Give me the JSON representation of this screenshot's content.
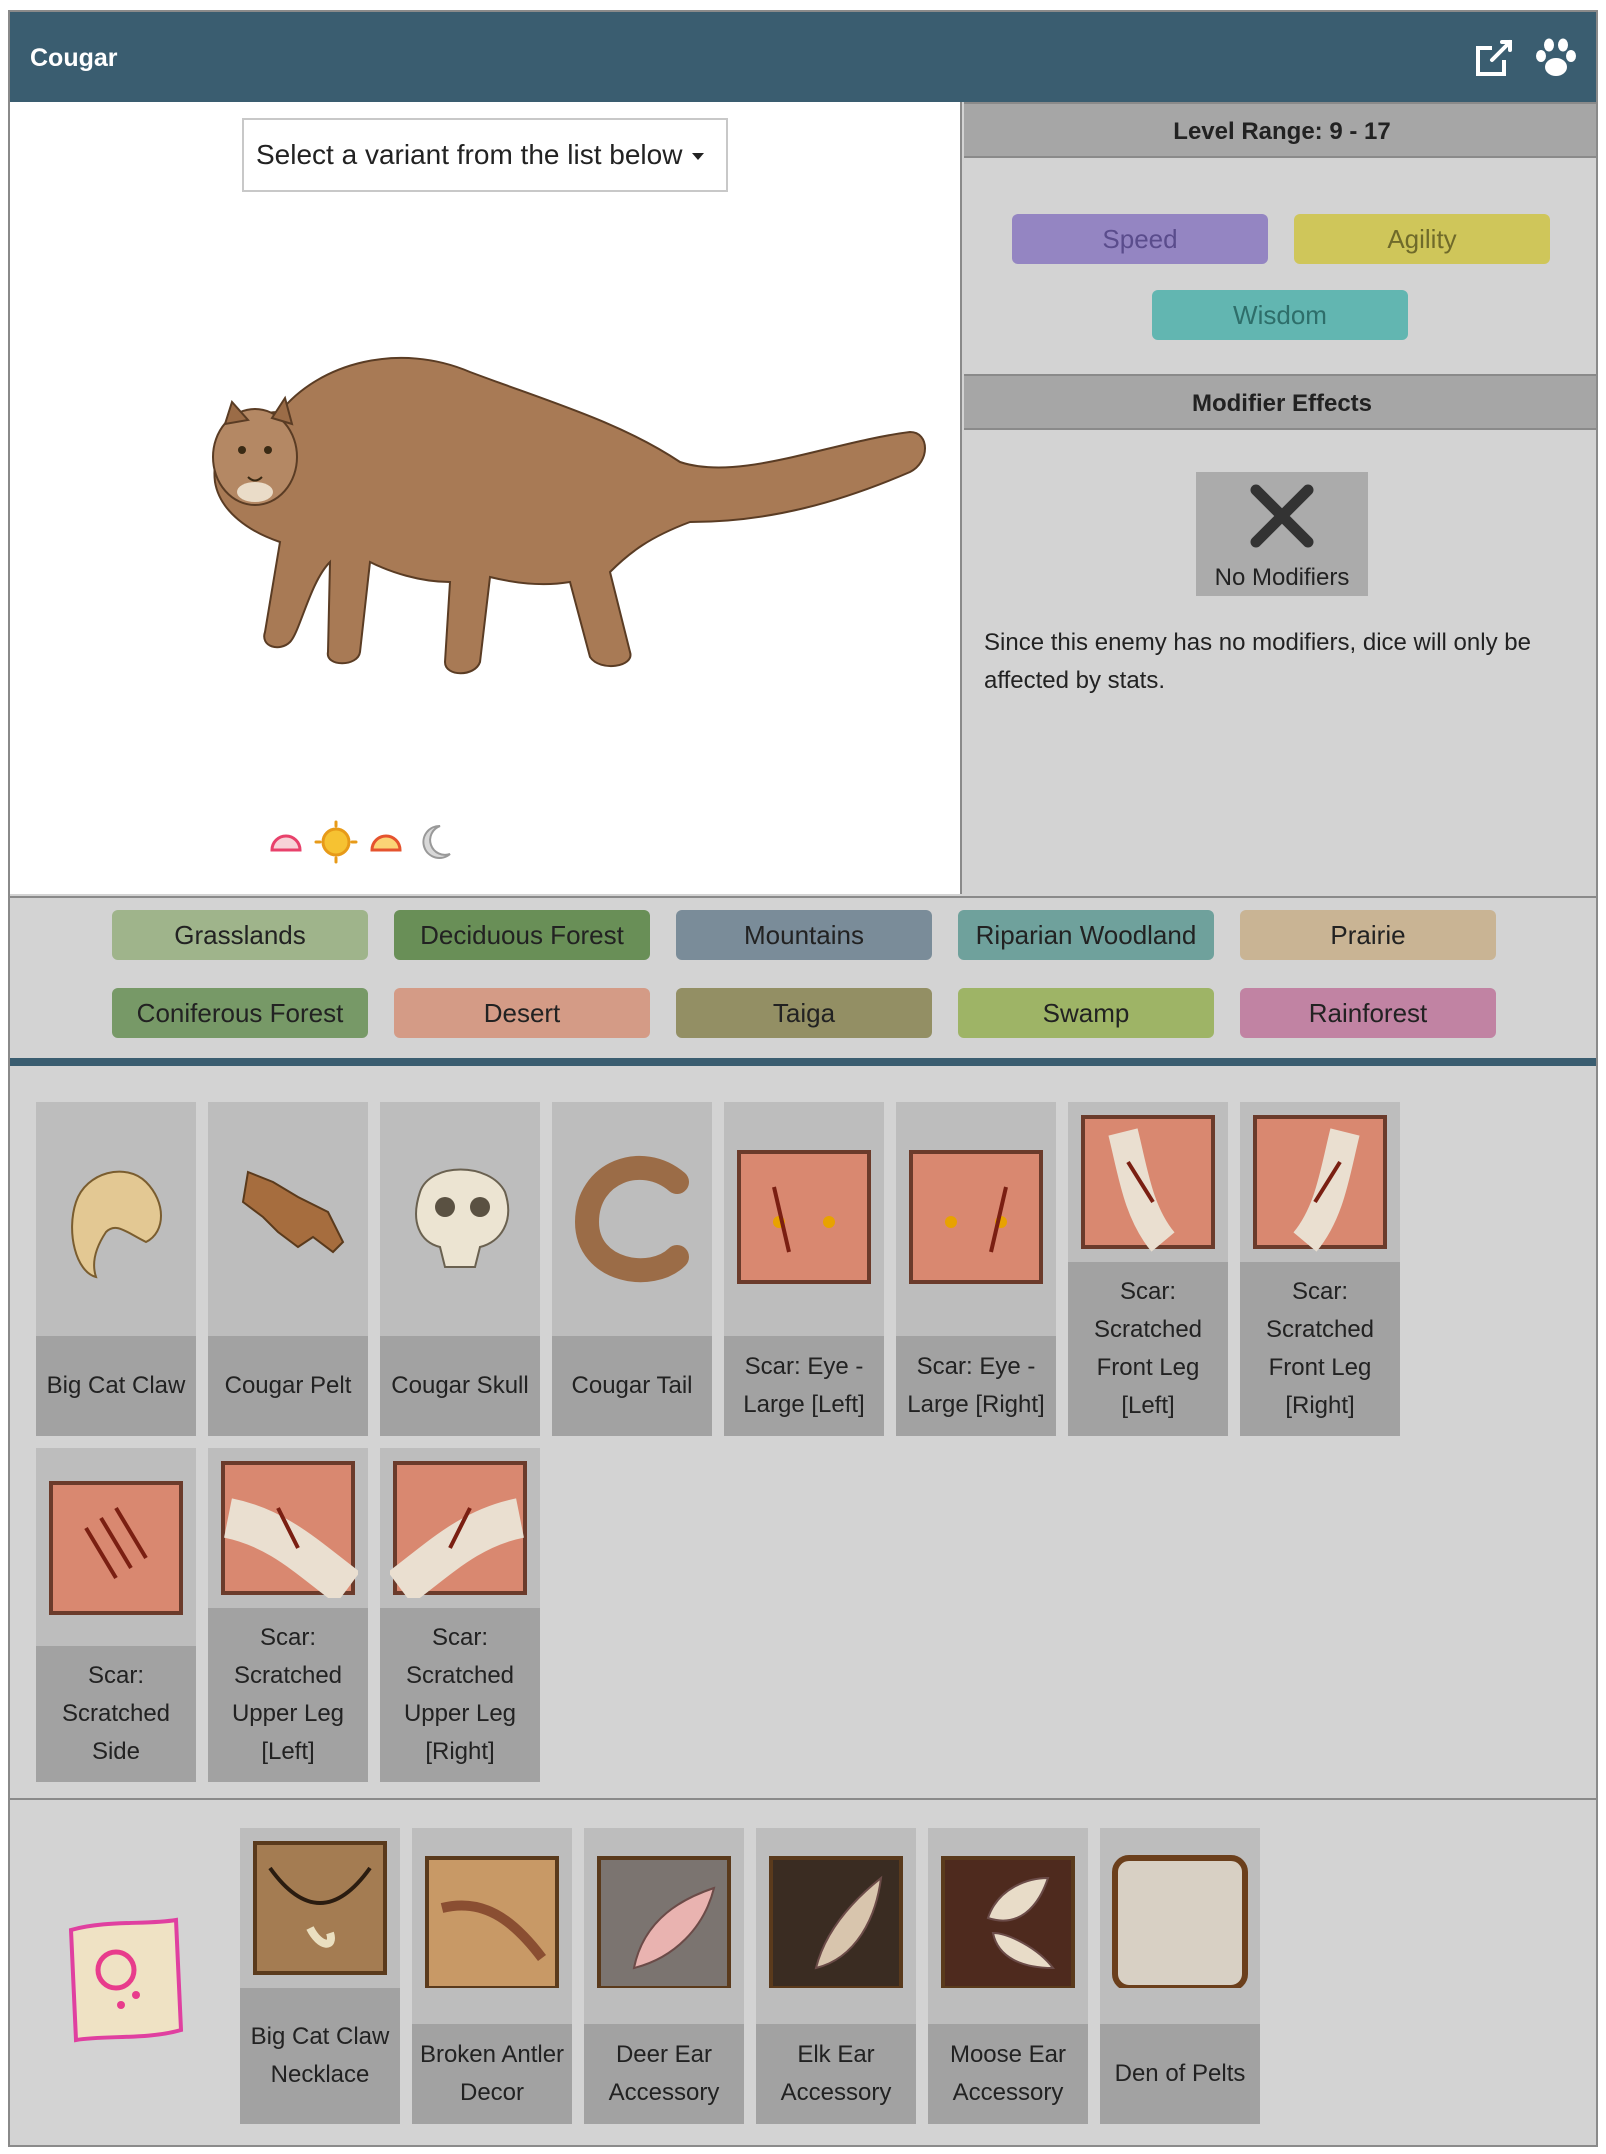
{
  "header": {
    "title": "Cougar",
    "external_link_icon": "external-link-icon",
    "paw_icon": "paw-icon"
  },
  "variant_select": {
    "label": "Select a variant from the list below"
  },
  "time_of_day": [
    "dawn-icon",
    "day-icon",
    "dusk-icon",
    "night-icon"
  ],
  "level_range": {
    "label": "Level Range: 9 - 17"
  },
  "stats": [
    {
      "label": "Speed",
      "color": "#9485c2",
      "text_color": "#5a4c8c"
    },
    {
      "label": "Agility",
      "color": "#cfc65a",
      "text_color": "#6f6a2a"
    },
    {
      "label": "Wisdom",
      "color": "#62b6b1",
      "text_color": "#2e6e6a"
    }
  ],
  "modifier_effects": {
    "title": "Modifier Effects",
    "no_modifiers_label": "No Modifiers",
    "description": "Since this enemy has no modifiers, dice will only be affected by stats."
  },
  "habitats": [
    {
      "label": "Grasslands",
      "color": "#9fb48b"
    },
    {
      "label": "Deciduous Forest",
      "color": "#698f57"
    },
    {
      "label": "Mountains",
      "color": "#7a8c99"
    },
    {
      "label": "Riparian Woodland",
      "color": "#6fa19c"
    },
    {
      "label": "Prairie",
      "color": "#c9b494"
    },
    {
      "label": "Coniferous Forest",
      "color": "#779967"
    },
    {
      "label": "Desert",
      "color": "#d49b86"
    },
    {
      "label": "Taiga",
      "color": "#938f64"
    },
    {
      "label": "Swamp",
      "color": "#9eb466"
    },
    {
      "label": "Rainforest",
      "color": "#c183a3"
    }
  ],
  "drops": [
    {
      "name": "Big Cat Claw",
      "icon": "claw-icon"
    },
    {
      "name": "Cougar Pelt",
      "icon": "pelt-icon"
    },
    {
      "name": "Cougar Skull",
      "icon": "skull-icon"
    },
    {
      "name": "Cougar Tail",
      "icon": "tail-icon"
    },
    {
      "name": "Scar: Eye - Large [Left]",
      "icon": "scar-eye-icon"
    },
    {
      "name": "Scar: Eye - Large [Right]",
      "icon": "scar-eye-icon"
    },
    {
      "name": "Scar: Scratched Front Leg [Left]",
      "icon": "scar-leg-icon"
    },
    {
      "name": "Scar: Scratched Front Leg [Right]",
      "icon": "scar-leg-icon"
    },
    {
      "name": "Scar: Scratched Side",
      "icon": "scar-side-icon"
    },
    {
      "name": "Scar: Scratched Upper Leg [Left]",
      "icon": "scar-leg-icon"
    },
    {
      "name": "Scar: Scratched Upper Leg [Right]",
      "icon": "scar-leg-icon"
    }
  ],
  "recipes": {
    "scroll_icon": "recipe-scroll-icon",
    "items": [
      {
        "name": "Big Cat Claw Necklace",
        "icon": "necklace-icon"
      },
      {
        "name": "Broken Antler Decor",
        "icon": "antler-icon"
      },
      {
        "name": "Deer Ear Accessory",
        "icon": "ear-icon"
      },
      {
        "name": "Elk Ear Accessory",
        "icon": "ear-icon"
      },
      {
        "name": "Moose Ear Accessory",
        "icon": "ear-icon"
      },
      {
        "name": "Den of Pelts",
        "icon": "pelts-icon"
      }
    ]
  }
}
